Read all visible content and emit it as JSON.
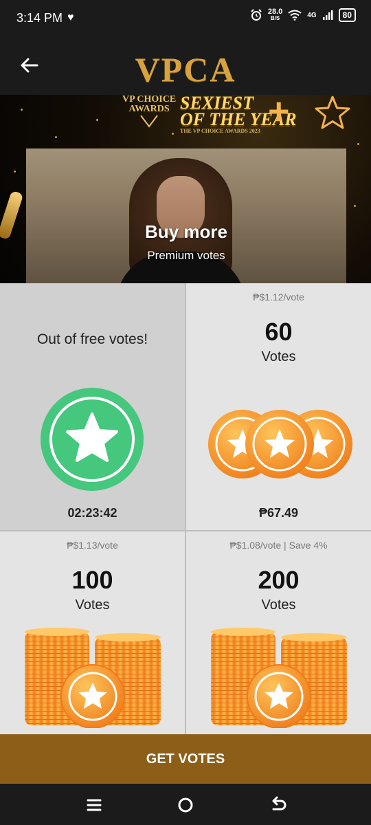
{
  "status_bar": {
    "time": "3:14 PM",
    "net_speed_value": "28.0",
    "net_speed_unit": "B/S",
    "network": "4G",
    "battery": "80"
  },
  "app_bar": {
    "title": "VPCA"
  },
  "banner": {
    "award_line1": "VP CHOICE",
    "award_line2": "AWARDS",
    "headline_line1": "SEXIEST",
    "headline_line2": "OF THE YEAR",
    "headline_small": "THE VP CHOICE AWARDS 2023",
    "cta_title": "Buy more",
    "cta_subtitle": "Premium votes"
  },
  "free_votes": {
    "message": "Out of free votes!",
    "timer": "02:23:42"
  },
  "packs": [
    {
      "per_vote": "₱$1.12/vote",
      "count": "60",
      "label": "Votes",
      "price": "₱67.49"
    },
    {
      "per_vote": "₱$1.13/vote",
      "count": "100",
      "label": "Votes"
    },
    {
      "per_vote": "₱$1.08/vote | Save 4%",
      "count": "200",
      "label": "Votes"
    }
  ],
  "actions": {
    "get_votes": "GET VOTES"
  },
  "colors": {
    "accent_gold": "#d8a23c",
    "button_brown": "#8c5e17",
    "free_green": "#45c77d",
    "coin_orange": "#f59a2a"
  }
}
